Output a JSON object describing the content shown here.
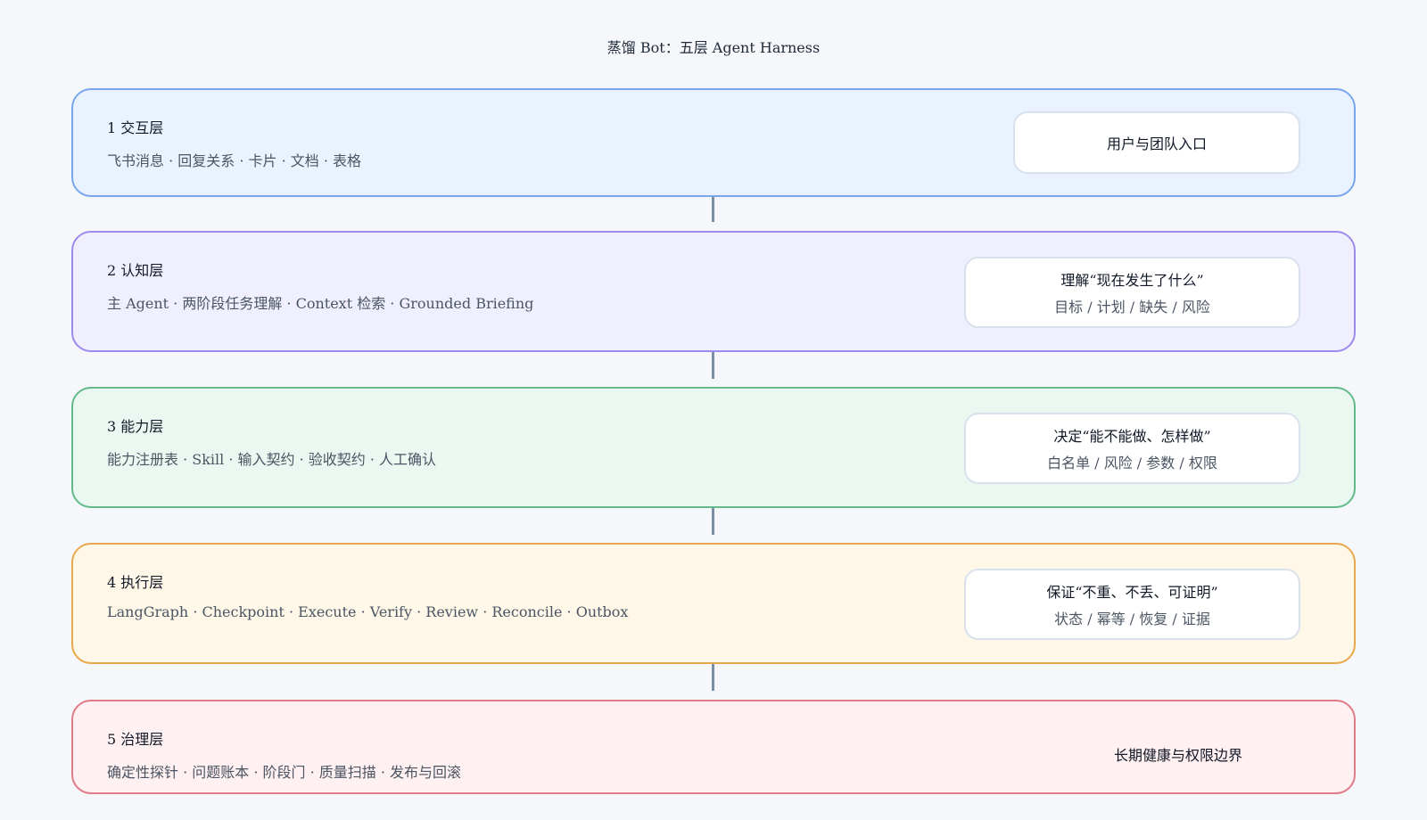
{
  "title": "蒸馏 Bot：五层 Agent Harness",
  "layers": [
    {
      "title": "1 交互层",
      "description": "飞书消息 · 回复关系 · 卡片 · 文档 · 表格",
      "note": "用户与团队入口"
    },
    {
      "title": "2 认知层",
      "description": "主 Agent · 两阶段任务理解 · Context 检索 · Grounded Briefing",
      "note": "理解“现在发生了什么”",
      "subnote": "目标 / 计划 / 缺失 / 风险"
    },
    {
      "title": "3 能力层",
      "description": "能力注册表 · Skill · 输入契约 · 验收契约 · 人工确认",
      "note": "决定“能不能做、怎样做”",
      "subnote": "白名单 / 风险 / 参数 / 权限"
    },
    {
      "title": "4 执行层",
      "description": "LangGraph · Checkpoint · Execute · Verify · Review · Reconcile · Outbox",
      "note": "保证“不重、不丢、可证明”",
      "subnote": "状态 / 幂等 / 恢复 / 证据"
    },
    {
      "title": "5 治理层",
      "description": "确定性探针 · 问题账本 · 阶段门 · 质量扫描 · 发布与回滚",
      "note": "长期健康与权限边界"
    }
  ]
}
